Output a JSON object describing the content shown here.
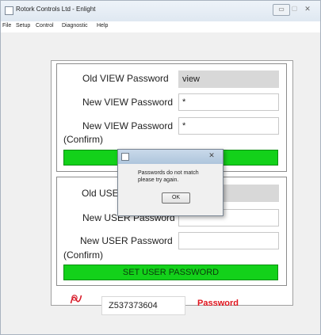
{
  "window": {
    "title": "Rotork Controls Ltd - Enlight",
    "minimize": "▭",
    "maximize": "▢",
    "close": "✕"
  },
  "menu": [
    "File",
    "Setup",
    "Control",
    "Diagnostic",
    "Help"
  ],
  "view_group": {
    "old_label": "Old VIEW Password",
    "old_value": "view",
    "new_label": "New VIEW Password",
    "new_value": "*",
    "confirm_label_1": "New VIEW Password",
    "confirm_label_2": "(Confirm)",
    "confirm_value": "*",
    "button_label": ""
  },
  "user_group": {
    "old_label": "Old USER",
    "old_value": "",
    "new_label": "New USER Password",
    "new_value": "",
    "confirm_label_1": "New USER Password",
    "confirm_label_2": "(Confirm)",
    "confirm_value": "",
    "button_label": "SET USER PASSWORD"
  },
  "status": {
    "serial": "Z537373604",
    "mode": "Password",
    "mode_color": "#e0151e"
  },
  "dialog": {
    "title": "",
    "message_line1": "Passwords do not match",
    "message_line2": "please try again.",
    "ok_label": "OK",
    "close": "✕"
  },
  "colors": {
    "accent_green": "#13d11a"
  },
  "icons": [
    "window-app-icon",
    "rotork-logo-icon",
    "dialog-app-icon"
  ]
}
